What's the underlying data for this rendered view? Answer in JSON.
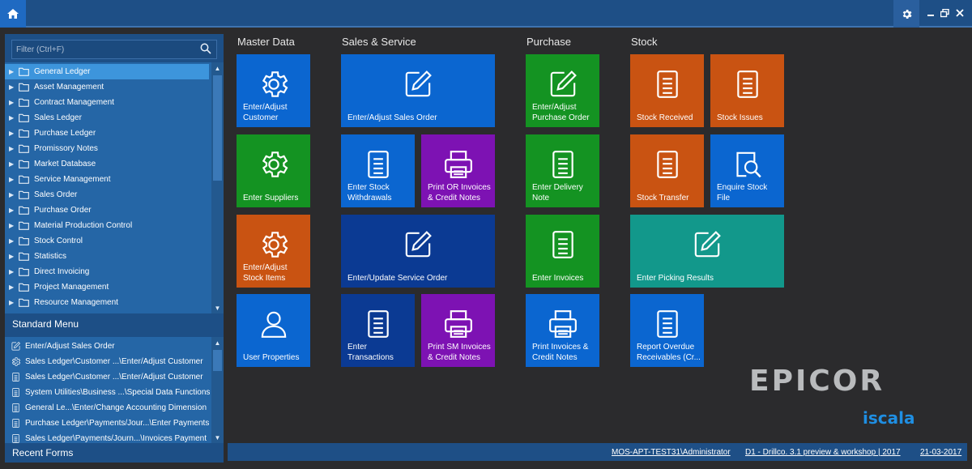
{
  "colors": {
    "topbar": "#1e4f86",
    "tile_blue": "#0b66d0",
    "tile_darkblue": "#0b3a93",
    "tile_green": "#149322",
    "tile_orange": "#c95312",
    "tile_purple": "#7d12b3",
    "tile_teal": "#12988b"
  },
  "sidebar": {
    "filter_placeholder": "Filter (Ctrl+F)",
    "tree": [
      {
        "label": "General Ledger",
        "selected": true
      },
      {
        "label": "Asset Management"
      },
      {
        "label": "Contract Management"
      },
      {
        "label": "Sales Ledger"
      },
      {
        "label": "Purchase Ledger"
      },
      {
        "label": "Promissory Notes"
      },
      {
        "label": "Market Database"
      },
      {
        "label": "Service Management"
      },
      {
        "label": "Sales Order"
      },
      {
        "label": "Purchase Order"
      },
      {
        "label": "Material Production Control"
      },
      {
        "label": "Stock Control"
      },
      {
        "label": "Statistics"
      },
      {
        "label": "Direct Invoicing"
      },
      {
        "label": "Project Management"
      },
      {
        "label": "Resource Management"
      }
    ],
    "standard_menu_label": "Standard Menu",
    "recent_items": [
      {
        "label": "Enter/Adjust Sales Order",
        "icon": "edit-icon"
      },
      {
        "label": "Sales Ledger\\Customer ...\\Enter/Adjust Customer",
        "icon": "gear-icon"
      },
      {
        "label": "Sales Ledger\\Customer ...\\Enter/Adjust Customer",
        "icon": "document-icon"
      },
      {
        "label": "System Utilities\\Business ...\\Special Data Functions",
        "icon": "document-icon"
      },
      {
        "label": "General Le...\\Enter/Change Accounting Dimension",
        "icon": "document-icon"
      },
      {
        "label": "Purchase Ledger\\Payments/Jour...\\Enter Payments",
        "icon": "document-icon"
      },
      {
        "label": "Sales Ledger\\Payments/Journ...\\Invoices Payment",
        "icon": "document-icon"
      }
    ],
    "recent_forms_label": "Recent Forms"
  },
  "groups": {
    "master_data": "Master Data",
    "sales_service": "Sales & Service",
    "purchase": "Purchase",
    "stock": "Stock"
  },
  "tiles": [
    {
      "label": "Enter/Adjust\nCustomer",
      "icon": "gear-icon",
      "color": "#0b66d0"
    },
    {
      "label": "Enter Suppliers",
      "icon": "gear-icon",
      "color": "#149322"
    },
    {
      "label": "Enter/Adjust\nStock Items",
      "icon": "gear-icon",
      "color": "#c95312"
    },
    {
      "label": "User Properties",
      "icon": "user-icon",
      "color": "#0b66d0"
    },
    {
      "label": "Enter/Adjust Sales Order",
      "icon": "edit-icon",
      "color": "#0b66d0"
    },
    {
      "label": "Enter Stock\nWithdrawals",
      "icon": "document-icon",
      "color": "#0b66d0"
    },
    {
      "label": "Print OR Invoices\n& Credit Notes",
      "icon": "printer-icon",
      "color": "#7d12b3"
    },
    {
      "label": "Enter/Update Service Order",
      "icon": "edit-icon",
      "color": "#0b3a93"
    },
    {
      "label": "Enter\nTransactions",
      "icon": "document-icon",
      "color": "#0b3a93"
    },
    {
      "label": "Print SM Invoices\n& Credit Notes",
      "icon": "printer-icon",
      "color": "#7d12b3"
    },
    {
      "label": "Enter/Adjust\nPurchase Order",
      "icon": "edit-icon",
      "color": "#149322"
    },
    {
      "label": "Enter Delivery\nNote",
      "icon": "document-icon",
      "color": "#149322"
    },
    {
      "label": "Enter Invoices",
      "icon": "document-icon",
      "color": "#149322"
    },
    {
      "label": "Print Invoices &\nCredit Notes",
      "icon": "printer-icon",
      "color": "#0b66d0"
    },
    {
      "label": "Stock Received",
      "icon": "document-icon",
      "color": "#c95312"
    },
    {
      "label": "Stock Issues",
      "icon": "document-icon",
      "color": "#c95312"
    },
    {
      "label": "Stock Transfer",
      "icon": "document-icon",
      "color": "#c95312"
    },
    {
      "label": "Enquire Stock\nFile",
      "icon": "search-document-icon",
      "color": "#0b66d0"
    },
    {
      "label": "Enter Picking Results",
      "icon": "edit-icon",
      "color": "#12988b"
    },
    {
      "label": "Report Overdue\nReceivables (Cr...",
      "icon": "document-icon",
      "color": "#0b66d0"
    }
  ],
  "status": {
    "server_user": "MOS-APT-TEST31\\Administrator",
    "company": "D1 - Drillco. 3.1 preview & workshop | 2017",
    "date": "21-03-2017"
  },
  "branding": {
    "epicor": "EPICOR",
    "iscala": "iscala"
  }
}
